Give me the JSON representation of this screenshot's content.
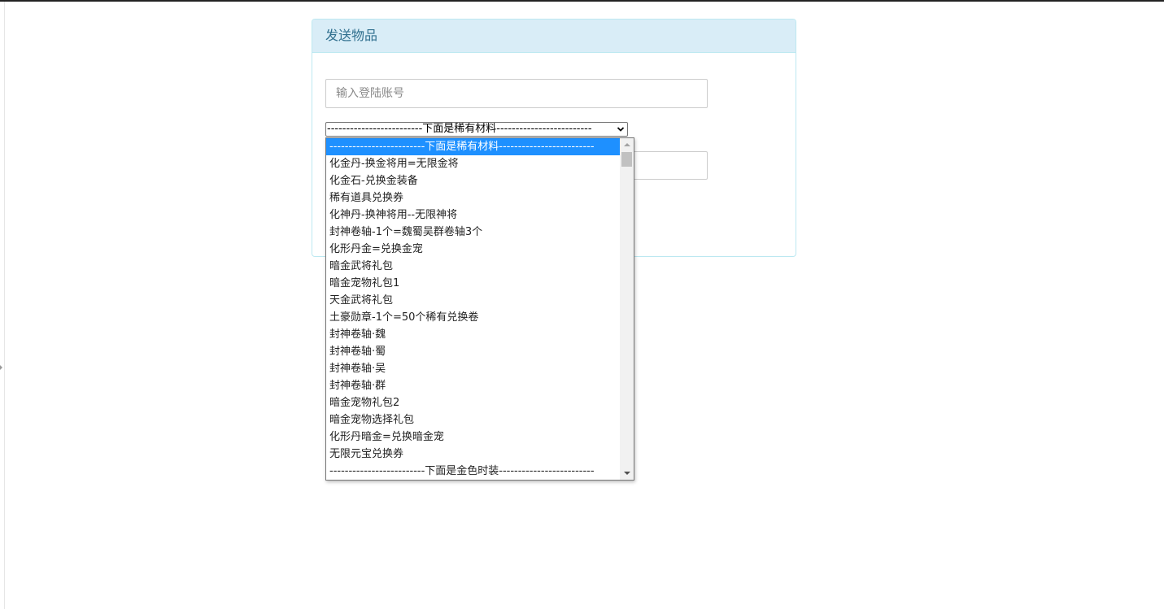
{
  "panel": {
    "title": "发送物品"
  },
  "form": {
    "account_placeholder": "输入登陆账号",
    "select_value": "-------------------------下面是稀有材料-------------------------"
  },
  "dropdown": {
    "options": [
      "-------------------------下面是稀有材料-------------------------",
      "化金丹-换金将用=无限金将",
      "化金石-兑换金装备",
      "稀有道具兑换券",
      "化神丹-换神将用--无限神将",
      "封神卷轴-1个=魏蜀吴群卷轴3个",
      "化形丹金=兑换金宠",
      "暗金武将礼包",
      "暗金宠物礼包1",
      "天金武将礼包",
      "土豪勋章-1个=50个稀有兑换卷",
      "封神卷轴·魏",
      "封神卷轴·蜀",
      "封神卷轴·吴",
      "封神卷轴·群",
      "暗金宠物礼包2",
      "暗金宠物选择礼包",
      "化形丹暗金=兑换暗金宠",
      "无限元宝兑换券",
      "-------------------------下面是金色时装-------------------------"
    ],
    "selected_index": 0
  },
  "colors": {
    "panel_heading_bg": "#d9edf7",
    "panel_border": "#bce8f1",
    "panel_title": "#31708f",
    "selected_option_bg": "#1e90ff"
  }
}
